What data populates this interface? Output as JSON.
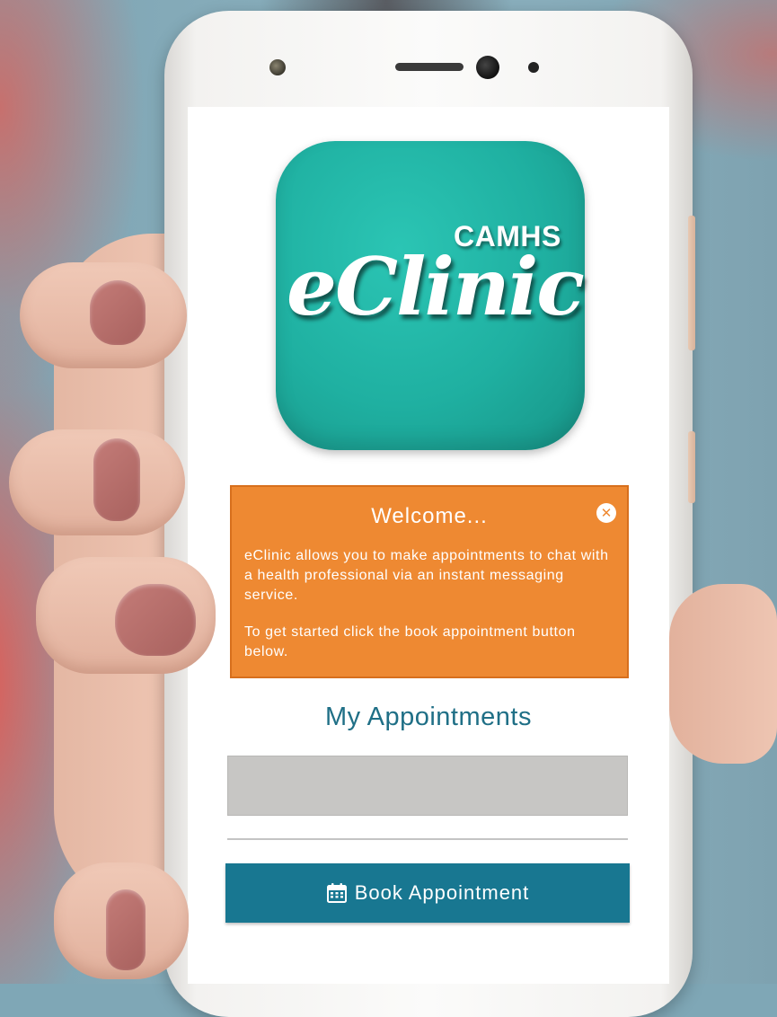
{
  "app_icon": {
    "small_text": "CAMHS",
    "large_text": "eClinic",
    "icon": "eclinic-app-icon"
  },
  "welcome": {
    "title": "Welcome...",
    "close_icon": "close-circle-icon",
    "paragraph_1": "eClinic allows you to make appointments to chat with a health professional via an instant messaging service.",
    "paragraph_2": "To get started click the book appointment button below."
  },
  "appointments": {
    "heading": "My Appointments",
    "items": []
  },
  "book_button": {
    "label": "Book Appointment",
    "icon": "calendar-icon"
  },
  "colors": {
    "teal_icon": "#1fb0a1",
    "orange_banner": "#ee8932",
    "heading_blue": "#1f6f86",
    "button_blue": "#187791",
    "list_gray": "#c7c6c4"
  }
}
